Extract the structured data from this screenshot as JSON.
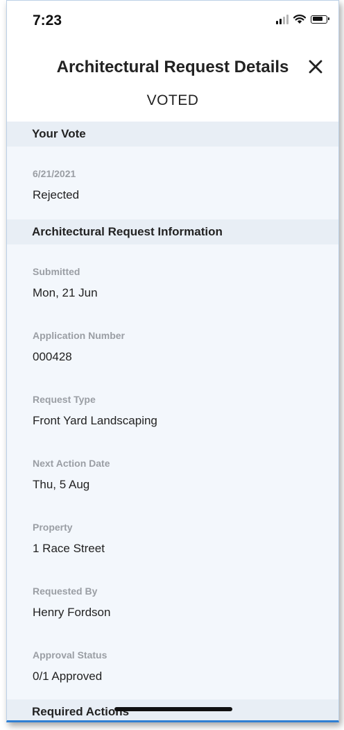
{
  "status_bar": {
    "time": "7:23",
    "icons": [
      "cellular-signal-icon",
      "wifi-icon",
      "battery-icon"
    ]
  },
  "header": {
    "title": "Architectural Request Details",
    "close_icon": "close-icon",
    "status": "VOTED"
  },
  "your_vote": {
    "section_title": "Your Vote",
    "date": "6/21/2021",
    "value": "Rejected"
  },
  "info": {
    "section_title": "Architectural Request Information",
    "fields": [
      {
        "label": "Submitted",
        "value": "Mon, 21 Jun"
      },
      {
        "label": "Application Number",
        "value": "000428"
      },
      {
        "label": "Request Type",
        "value": "Front Yard Landscaping"
      },
      {
        "label": "Next Action Date",
        "value": "Thu, 5 Aug"
      },
      {
        "label": "Property",
        "value": "1 Race Street"
      },
      {
        "label": "Requested By",
        "value": "Henry Fordson"
      },
      {
        "label": "Approval Status",
        "value": "0/1 Approved"
      }
    ]
  },
  "required_actions": {
    "section_title": "Required Actions"
  },
  "colors": {
    "section_bg": "#e8eef5",
    "content_bg": "#f3f7fc",
    "label_gray": "#9a9ea4",
    "accent_border": "#2f7fd3"
  }
}
